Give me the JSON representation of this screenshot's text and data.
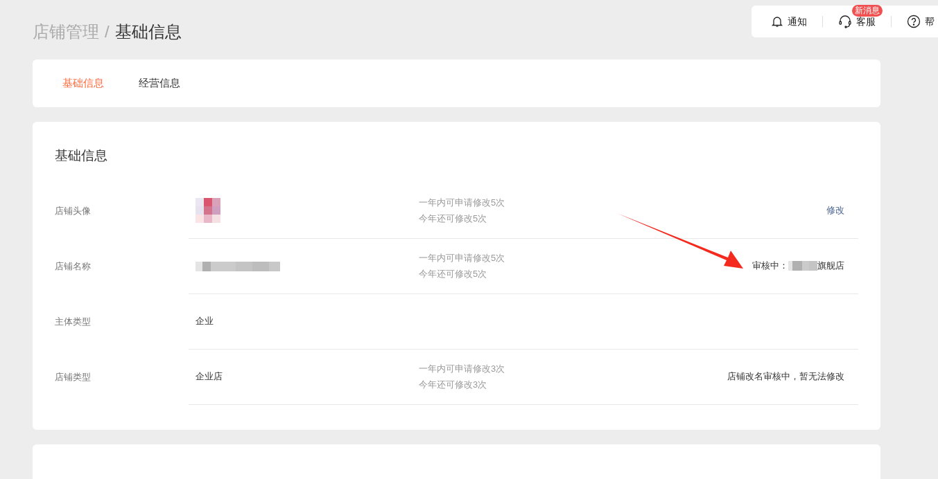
{
  "breadcrumb": {
    "parent": "店铺管理",
    "separator": "/",
    "current": "基础信息"
  },
  "top_bar": [
    {
      "kind": "bell",
      "label": "通知"
    },
    {
      "kind": "headset",
      "label": "客服",
      "badge": "新消息"
    },
    {
      "kind": "help",
      "label": "帮"
    }
  ],
  "tabs": [
    {
      "label": "基础信息",
      "selected": true
    },
    {
      "label": "经营信息",
      "selected": false
    }
  ],
  "section": {
    "title": "基础信息",
    "rows": [
      {
        "kind": "avatar",
        "label": "店铺头像",
        "notes": [
          "一年内可申请修改5次",
          "今年还可修改5次"
        ],
        "action": "修改"
      },
      {
        "kind": "name",
        "label": "店铺名称",
        "notes": [
          "一年内可申请修改5次",
          "今年还可修改5次"
        ],
        "status_prefix": "审核中：",
        "status_suffix": "旗舰店"
      },
      {
        "kind": "text",
        "label": "主体类型",
        "value": "企业"
      },
      {
        "kind": "text",
        "label": "店铺类型",
        "value": "企业店",
        "notes": [
          "一年内可申请修改3次",
          "今年还可修改3次"
        ],
        "status": "店铺改名审核中，暂无法修改"
      }
    ]
  }
}
